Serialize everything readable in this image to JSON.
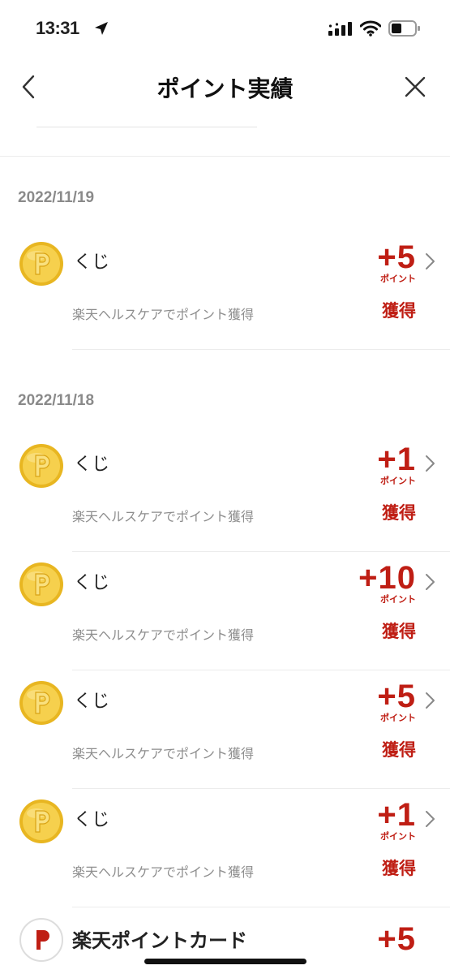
{
  "status_bar": {
    "time": "13:31",
    "icons": [
      "location-arrow-icon",
      "cellular-signal-icon",
      "wifi-icon",
      "battery-icon"
    ]
  },
  "nav": {
    "title": "ポイント実績",
    "back_icon": "chevron-left-icon",
    "close_icon": "close-icon"
  },
  "colors": {
    "accent": "#bf1e14",
    "date_text": "#8a8a8a",
    "sub_text": "#8e8e8e",
    "coin_gold": "#f2c531"
  },
  "groups": [
    {
      "date": "2022/11/19",
      "items": [
        {
          "title": "くじ",
          "subtitle": "楽天ヘルスケアでポイント獲得",
          "points": "+5",
          "unit": "ポイント",
          "status": "獲得"
        }
      ]
    },
    {
      "date": "2022/11/18",
      "items": [
        {
          "title": "くじ",
          "subtitle": "楽天ヘルスケアでポイント獲得",
          "points": "+1",
          "unit": "ポイント",
          "status": "獲得"
        },
        {
          "title": "くじ",
          "subtitle": "楽天ヘルスケアでポイント獲得",
          "points": "+10",
          "unit": "ポイント",
          "status": "獲得"
        },
        {
          "title": "くじ",
          "subtitle": "楽天ヘルスケアでポイント獲得",
          "points": "+5",
          "unit": "ポイント",
          "status": "獲得"
        },
        {
          "title": "くじ",
          "subtitle": "楽天ヘルスケアでポイント獲得",
          "points": "+1",
          "unit": "ポイント",
          "status": "獲得"
        }
      ]
    }
  ],
  "partial_item": {
    "title": "楽天ポイントカード",
    "points": "+5"
  }
}
